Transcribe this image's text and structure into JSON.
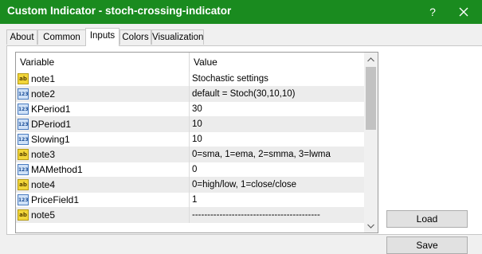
{
  "window": {
    "title": "Custom Indicator - stoch-crossing-indicator",
    "help_label": "?"
  },
  "tabs": [
    {
      "label": "About",
      "active": false
    },
    {
      "label": "Common",
      "active": false
    },
    {
      "label": "Inputs",
      "active": true
    },
    {
      "label": "Colors",
      "active": false
    },
    {
      "label": "Visualization",
      "active": false
    }
  ],
  "grid": {
    "columns": {
      "variable": "Variable",
      "value": "Value"
    },
    "rows": [
      {
        "type": "ab",
        "icon_label": "ab",
        "name": "note1",
        "value": "Stochastic settings"
      },
      {
        "type": "n123",
        "icon_label": "123",
        "name": "note2",
        "value": "default = Stoch(30,10,10)"
      },
      {
        "type": "n123",
        "icon_label": "123",
        "name": "KPeriod1",
        "value": "30"
      },
      {
        "type": "n123",
        "icon_label": "123",
        "name": "DPeriod1",
        "value": "10"
      },
      {
        "type": "n123",
        "icon_label": "123",
        "name": "Slowing1",
        "value": "10"
      },
      {
        "type": "ab",
        "icon_label": "ab",
        "name": "note3",
        "value": "0=sma, 1=ema, 2=smma, 3=lwma"
      },
      {
        "type": "n123",
        "icon_label": "123",
        "name": "MAMethod1",
        "value": "0"
      },
      {
        "type": "ab",
        "icon_label": "ab",
        "name": "note4",
        "value": "0=high/low, 1=close/close"
      },
      {
        "type": "n123",
        "icon_label": "123",
        "name": "PriceField1",
        "value": "1"
      },
      {
        "type": "ab",
        "icon_label": "ab",
        "name": "note5",
        "value": "------------------------------------------"
      }
    ]
  },
  "buttons": {
    "load": "Load",
    "save": "Save"
  },
  "colors": {
    "titlebar": "#1a8b1f",
    "ab_icon": "#f2d63a",
    "num_icon": "#cfe1f7"
  }
}
